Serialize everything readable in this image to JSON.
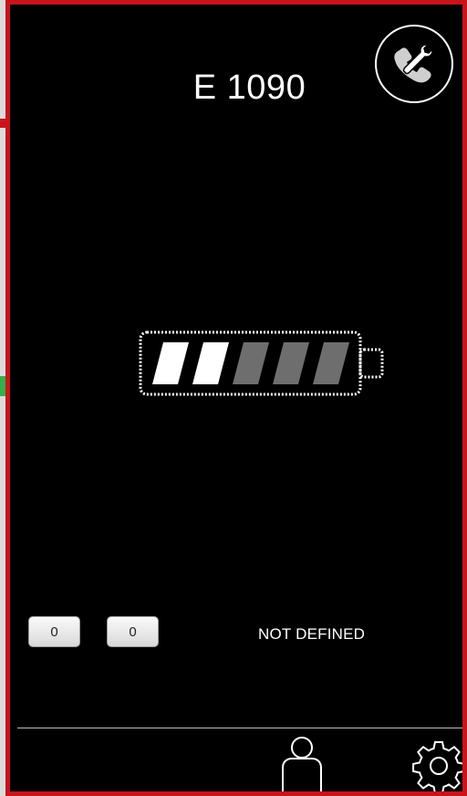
{
  "device": {
    "title": "E 1090",
    "battery_level_fraction": 0.4,
    "battery_segments_total": 5,
    "battery_segments_filled": 2
  },
  "counters": [
    "0",
    "0"
  ],
  "status_text": "NOT DEFINED",
  "icons": {
    "top_right": "phone-wrench-icon",
    "bottom_center": "person-icon",
    "bottom_right": "gear-icon"
  },
  "colors": {
    "frame": "#c8151b",
    "screen": "#000000",
    "foreground": "#ffffff",
    "battery_empty": "#6e6e6e"
  }
}
